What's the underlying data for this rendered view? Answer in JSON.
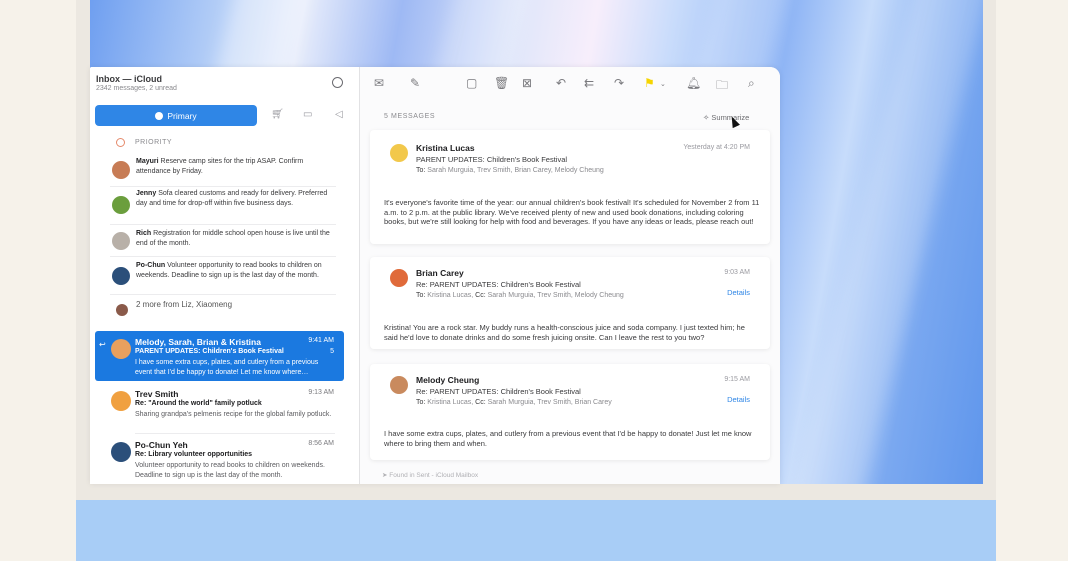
{
  "window": {
    "title": "Inbox — iCloud",
    "subtitle": "2342 messages, 2 unread"
  },
  "tabs": {
    "primary_label": "Primary",
    "icons": [
      "shopping-cart-icon",
      "chat-bubble-icon",
      "megaphone-icon"
    ]
  },
  "priority": {
    "label": "PRIORITY",
    "items": [
      {
        "name": "Mayuri",
        "text": "Reserve camp sites for the trip ASAP. Confirm attendance by Friday."
      },
      {
        "name": "Jenny",
        "text": "Sofa cleared customs and ready for delivery. Preferred day and time for drop-off within five business days."
      },
      {
        "name": "Rich",
        "text": "Registration for middle school open house is live until the end of the month."
      },
      {
        "name": "Po-Chun",
        "text": "Volunteer opportunity to read books to children on weekends. Deadline to sign up is the last day of the month."
      }
    ],
    "more": "2 more from Liz, Xiaomeng"
  },
  "messages": [
    {
      "from": "Melody, Sarah, Brian & Kristina",
      "time": "9:41 AM",
      "subject": "PARENT UPDATES: Children's Book Festival",
      "count": "5",
      "preview": "I have some extra cups, plates, and cutlery from a previous event that I'd be happy to donate! Let me know where…"
    },
    {
      "from": "Trev Smith",
      "time": "9:13 AM",
      "subject": "Re: \"Around the world\" family potluck",
      "preview": "Sharing grandpa's pelmenis recipe for the global family potluck."
    },
    {
      "from": "Po-Chun Yeh",
      "time": "8:56 AM",
      "subject": "Re: Library volunteer opportunities",
      "preview": "Volunteer opportunity to read books to children on weekends. Deadline to sign up is the last day of the month."
    }
  ],
  "thread": {
    "count_label": "5 MESSAGES",
    "summarize_label": "Summarize",
    "to_label": "To:",
    "cc_label": "Cc:",
    "details_label": "Details",
    "cards": [
      {
        "name": "Kristina Lucas",
        "subject": "PARENT UPDATES: Children's Book Festival",
        "to": "Sarah Murguia,   Trev Smith,   Brian Carey,   Melody Cheung",
        "time": "Yesterday at 4:20 PM",
        "body": "It's everyone's favorite time of the year: our annual children's book festival! It's scheduled for November 2 from 11 a.m. to 2 p.m. at the public library. We've received plenty of new and used book donations, including coloring books, but we're still looking for help with food and beverages. If you have any ideas or leads, please reach out!"
      },
      {
        "name": "Brian Carey",
        "subject": "Re: PARENT UPDATES: Children's Book Festival",
        "to": "Kristina Lucas,",
        "cc": "Sarah Murguia,   Trev Smith,   Melody Cheung",
        "time": "9:03 AM",
        "body": "Kristina! You are a rock star. My buddy runs a health-conscious juice and soda company. I just texted him; he said he'd love to donate drinks and do some fresh juicing onsite. Can I leave the rest to you two?"
      },
      {
        "name": "Melody Cheung",
        "subject": "Re: PARENT UPDATES: Children's Book Festival",
        "to": "Kristina Lucas,",
        "cc": "Sarah Murguia,   Trev Smith,   Brian Carey",
        "time": "9:15 AM",
        "body": "I have some extra cups, plates, and cutlery from a previous event that I'd be happy to donate! Just let me know where to bring them and when."
      }
    ],
    "footer": "Found in Sent - iCloud Mailbox"
  },
  "colors": {
    "accent": "#1b79e0",
    "tab_primary": "#2f86e6",
    "link": "#2f86e6"
  }
}
